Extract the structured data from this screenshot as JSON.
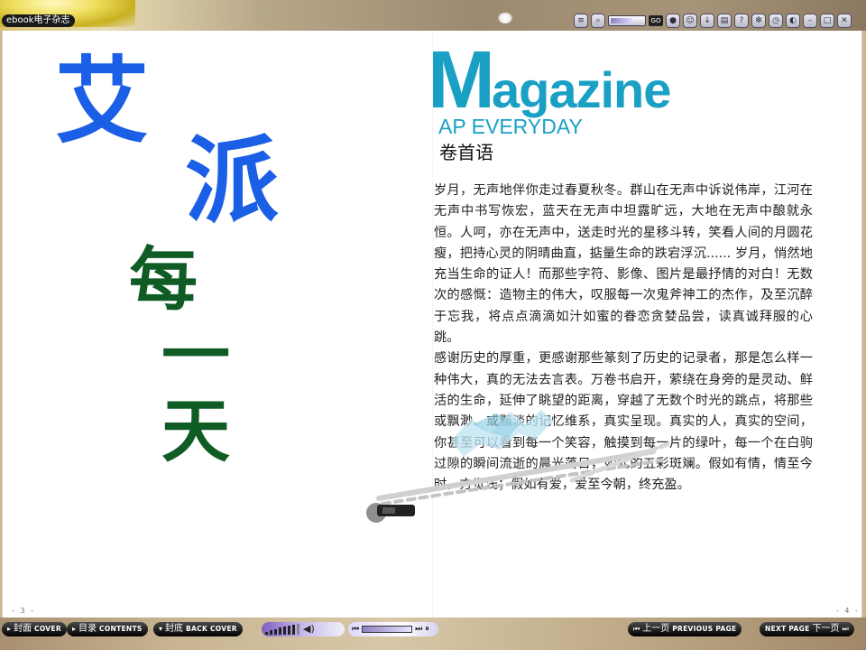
{
  "app": {
    "brand_label": "ebook电子杂志"
  },
  "toolbar": {
    "zoom_go_label": "GO",
    "buttons": [
      {
        "icon": "toc-icon"
      },
      {
        "icon": "zoom-icon"
      },
      {
        "icon": "zoom-go"
      },
      {
        "icon": "chat-icon"
      },
      {
        "icon": "user-icon"
      },
      {
        "icon": "download-icon"
      },
      {
        "icon": "print-icon"
      },
      {
        "icon": "help-icon"
      },
      {
        "icon": "settings-icon"
      },
      {
        "icon": "clock-icon"
      },
      {
        "icon": "sound-icon"
      },
      {
        "icon": "minimize-icon"
      },
      {
        "icon": "maximize-icon"
      },
      {
        "icon": "close-icon"
      }
    ]
  },
  "left_page": {
    "chars": [
      "艾",
      "派",
      "每",
      "一",
      "天"
    ],
    "colors": {
      "blue": "#1a5fe6",
      "green": "#0f5c24"
    },
    "page_number": "- 3 -"
  },
  "right_page": {
    "magazine_cap": "M",
    "magazine_rest": "agazine",
    "subtitle": "AP EVERYDAY",
    "section_title": "卷首语",
    "paragraphs": [
      "岁月，无声地伴你走过春夏秋冬。群山在无声中诉说伟岸，江河在无声中书写恢宏，蓝天在无声中坦露旷远，大地在无声中酿就永恒。人呵，亦在无声中，送走时光的星移斗转，笑看人间的月圆花瘦，把持心灵的阴晴曲直，掂量生命的跌宕浮沉...... 岁月，悄然地充当生命的证人！而那些字符、影像、图片是最抒情的对白！无数次的感慨：造物主的伟大，叹服每一次鬼斧神工的杰作，及至沉醉于忘我，将点点滴滴如汁如蜜的眷恋贪婪品尝，读真诚拜服的心跳。",
      "感谢历史的厚重，更感谢那些篆刻了历史的记录者，那是怎么样一种伟大，真的无法去言表。万卷书启开，萦绕在身旁的是灵动、鲜活的生命，延伸了眺望的距离，穿越了无数个时光的跳点，将那些或飘渺、或黯淡的记忆维系，真实呈现。真实的人，真实的空间，你甚至可以看到每一个笑容，触摸到每一片的绿叶，每一个在白驹过隙的瞬间流逝的晨光落日，如此的五彩斑斓。假如有情，情至今时，方觉浅；假如有爱，爱至今朝，终充盈。"
    ],
    "title_color": "#1aa0c4",
    "page_number": "- 4 -"
  },
  "bottom_nav": {
    "cover": {
      "zh": "封面",
      "en": "COVER"
    },
    "contents": {
      "zh": "目录",
      "en": "CONTENTS"
    },
    "back_cover": {
      "zh": "封底",
      "en": "BACK COVER"
    },
    "prev": {
      "zh": "上一页",
      "en": "PREVIOUS PAGE"
    },
    "next": {
      "zh": "下一页",
      "en": "NEXT PAGE"
    },
    "volume_level": 0.8
  }
}
